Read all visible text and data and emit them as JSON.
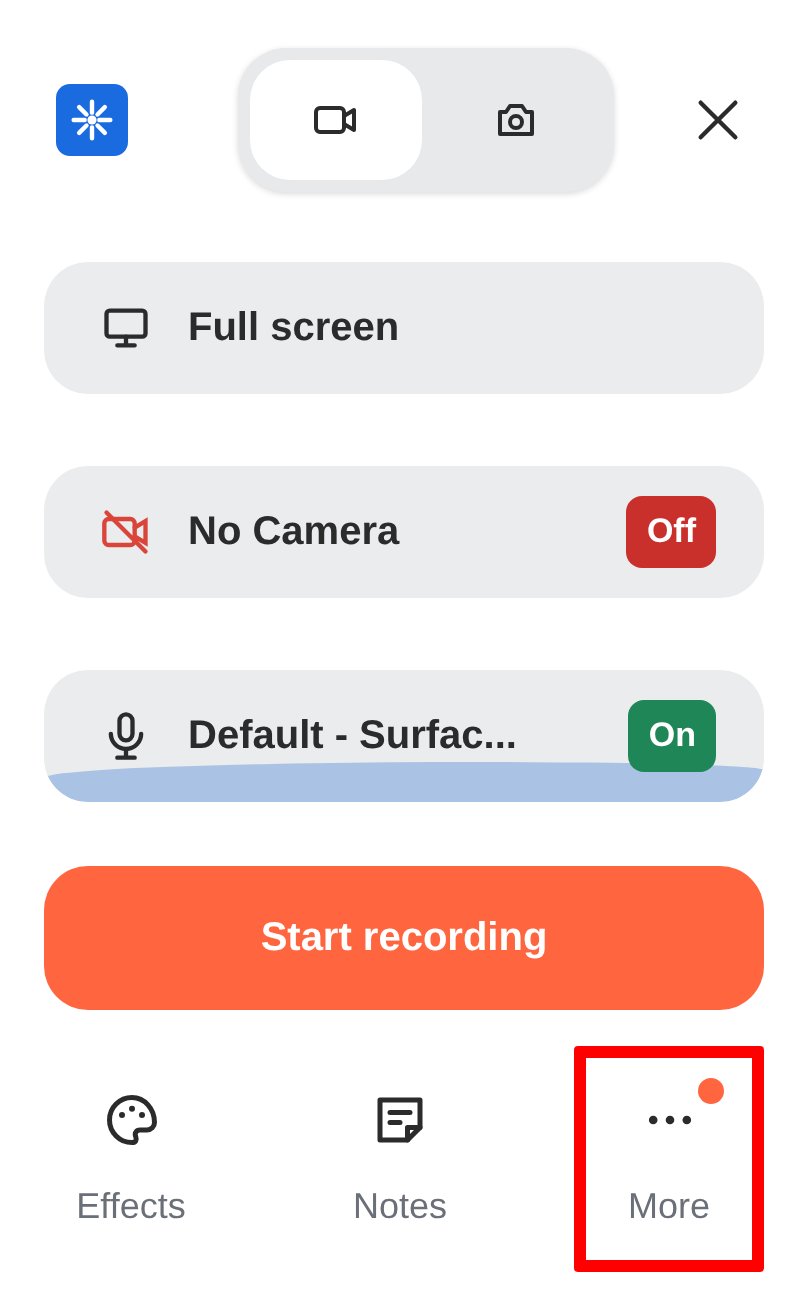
{
  "mode_toggle": [
    {
      "kind": "video",
      "selected": true
    },
    {
      "kind": "photo",
      "selected": false
    }
  ],
  "sources": [
    {
      "kind": "screen",
      "label": "Full screen"
    },
    {
      "kind": "camera",
      "label": "No Camera",
      "badge": "Off",
      "on": false
    },
    {
      "kind": "mic",
      "label": "Default - Surfac...",
      "badge": "On",
      "on": true
    }
  ],
  "start_button": "Start recording",
  "bottom_nav": [
    {
      "kind": "effects",
      "label": "Effects",
      "highlighted": false,
      "notification": false
    },
    {
      "kind": "notes",
      "label": "Notes",
      "highlighted": false,
      "notification": false
    },
    {
      "kind": "more",
      "label": "More",
      "highlighted": true,
      "notification": true
    }
  ]
}
